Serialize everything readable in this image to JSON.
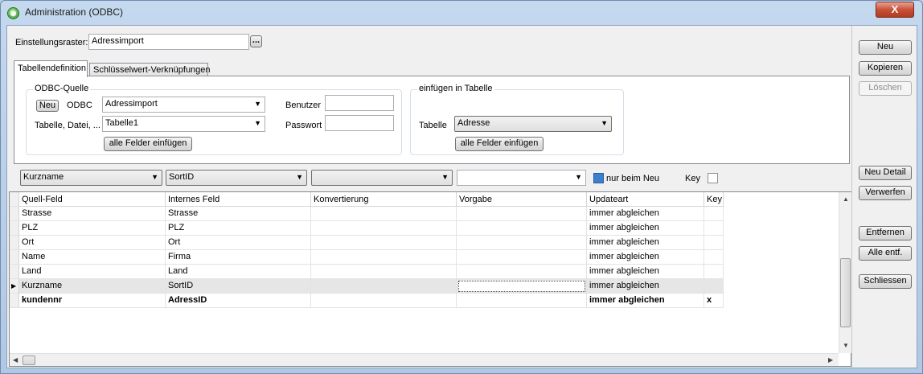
{
  "window": {
    "title": "Administration (ODBC)",
    "app_icon": "green-circle-icon",
    "close_label": "X"
  },
  "header": {
    "einstellungsraster_label": "Einstellungsraster:",
    "einstellungsraster_value": "Adressimport",
    "browse_label": "..."
  },
  "tabs": [
    {
      "label": "Tabellendefinition",
      "active": true
    },
    {
      "label": "Schlüsselwert-Verknüpfungen",
      "active": false
    }
  ],
  "odbc": {
    "group_title": "ODBC-Quelle",
    "new_button": "Neu",
    "odbc_label": "ODBC",
    "odbc_value": "Adressimport",
    "table_label": "Tabelle, Datei, ...",
    "table_value": "Tabelle1",
    "user_label": "Benutzer",
    "user_value": "",
    "password_label": "Passwort",
    "password_value": "",
    "insert_all_button": "alle Felder einfügen"
  },
  "target": {
    "group_title": "einfügen in Tabelle",
    "table_label": "Tabelle",
    "table_value": "Adresse",
    "insert_all_button": "alle Felder einfügen"
  },
  "filter": {
    "combo1": "Kurzname",
    "combo2": "SortID",
    "combo3": "",
    "combo4": "",
    "nur_beim_neu_label": "nur beim Neu",
    "nur_beim_neu_checked": true,
    "key_label": "Key",
    "key_checked": false
  },
  "grid": {
    "columns": [
      "Quell-Feld",
      "Internes Feld",
      "Konvertierung",
      "Vorgabe",
      "Updateart",
      "Key"
    ],
    "rows": [
      {
        "quell": "Strasse",
        "intern": "Strasse",
        "konv": "",
        "vorgabe": "",
        "update": "immer abgleichen",
        "key": "",
        "bold": false,
        "selected": false
      },
      {
        "quell": "PLZ",
        "intern": "PLZ",
        "konv": "",
        "vorgabe": "",
        "update": "immer abgleichen",
        "key": "",
        "bold": false,
        "selected": false
      },
      {
        "quell": "Ort",
        "intern": "Ort",
        "konv": "",
        "vorgabe": "",
        "update": "immer abgleichen",
        "key": "",
        "bold": false,
        "selected": false
      },
      {
        "quell": "Name",
        "intern": "Firma",
        "konv": "",
        "vorgabe": "",
        "update": "immer abgleichen",
        "key": "",
        "bold": false,
        "selected": false
      },
      {
        "quell": "Land",
        "intern": "Land",
        "konv": "",
        "vorgabe": "",
        "update": "immer abgleichen",
        "key": "",
        "bold": false,
        "selected": false
      },
      {
        "quell": "Kurzname",
        "intern": "SortID",
        "konv": "",
        "vorgabe": "",
        "update": "immer abgleichen",
        "key": "",
        "bold": false,
        "selected": true
      },
      {
        "quell": "kundennr",
        "intern": "AdressID",
        "konv": "",
        "vorgabe": "",
        "update": "immer abgleichen",
        "key": "x",
        "bold": true,
        "selected": false
      }
    ]
  },
  "side_buttons": {
    "neu": "Neu",
    "kopieren": "Kopieren",
    "loeschen": "Löschen",
    "neu_detail": "Neu Detail",
    "verwerfen": "Verwerfen",
    "entfernen": "Entfernen",
    "alle_entf": "Alle entf.",
    "schliessen": "Schliessen"
  },
  "colors": {
    "selected_row": "#e6e6e6",
    "title_bar": "#c4d8ee",
    "close_button": "#c7523a"
  }
}
